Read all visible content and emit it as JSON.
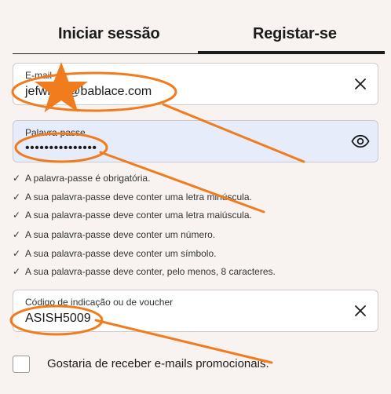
{
  "tabs": {
    "login_label": "Iniciar sessão",
    "register_label": "Registar-se"
  },
  "email": {
    "label": "E-mail",
    "value": "jefwi...3@bablace.com"
  },
  "password": {
    "label": "Palavra-passe",
    "value": "•••••••••••••••"
  },
  "rules": {
    "items": [
      "A palavra-passe é obrigatória.",
      "A sua palavra-passe deve conter uma letra minúscula.",
      "A sua palavra-passe deve conter uma letra maiúscula.",
      "A sua palavra-passe deve conter um número.",
      "A sua palavra-passe deve conter um símbolo.",
      "A sua palavra-passe deve conter, pelo menos, 8 caracteres."
    ],
    "check_glyph": "✓"
  },
  "voucher": {
    "label": "Código de indicação ou de voucher",
    "value": "ASISH5009"
  },
  "promo": {
    "label": "Gostaria de receber e-mails promocionais."
  },
  "annotation_color": "#f07c1e"
}
